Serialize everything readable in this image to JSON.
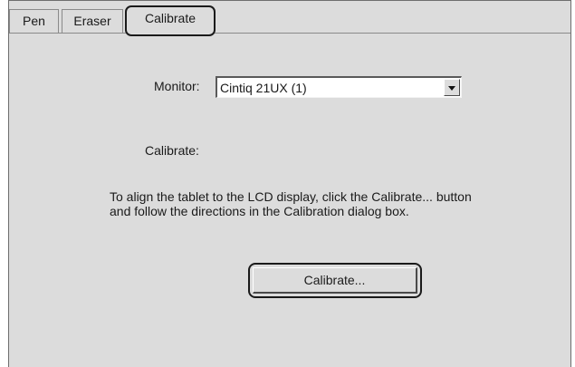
{
  "tabs": [
    {
      "label": "Pen",
      "selected": false
    },
    {
      "label": "Eraser",
      "selected": false
    },
    {
      "label": "Calibrate",
      "selected": true
    }
  ],
  "monitor": {
    "label": "Monitor:",
    "selected_value": "Cintiq 21UX (1)"
  },
  "calibrate": {
    "label": "Calibrate:",
    "instructions_line1": "To align the tablet to the LCD display, click the Calibrate... button",
    "instructions_line2": "and follow the directions in the Calibration dialog box.",
    "button_label": "Calibrate..."
  },
  "colors": {
    "panel_background": "#dcdcdc",
    "highlight_outline": "#1a1a1a"
  }
}
